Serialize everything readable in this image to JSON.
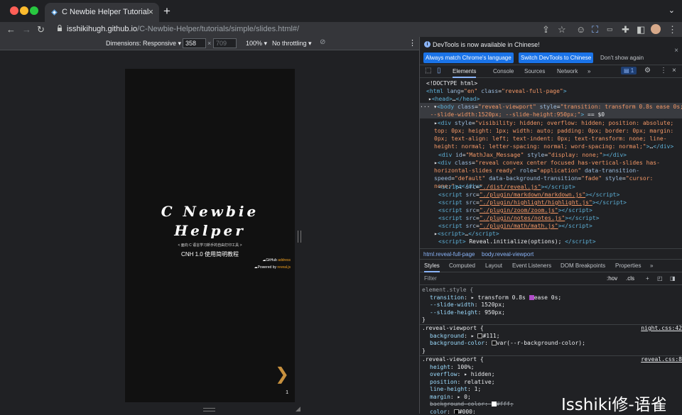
{
  "browser": {
    "tab_title": "C Newbie Helper Tutorial",
    "url_host": "isshikihugh.github.io",
    "url_path": "/C-Newbie-Helper/tutorials/simple/slides.html#/"
  },
  "devbar": {
    "dimensions": "Dimensions: Responsive ▾",
    "width": "358",
    "height": "709",
    "zoom": "100% ▾",
    "throttle": "No throttling ▾"
  },
  "slide": {
    "title1": "C Newbie",
    "title2": "Helper",
    "subtitle": "< 面向 C 语言学习新手的自由打印工具 >",
    "desc": "CNH 1.0 使用简明教程",
    "link1_prefix": "GitHub",
    "link1": "address",
    "link2_prefix": "Powered by",
    "link2": "reveal.js",
    "page": "1"
  },
  "notice": {
    "msg": "DevTools is now available in Chinese!",
    "btn1": "Always match Chrome's language",
    "btn2": "Switch DevTools to Chinese",
    "btn3": "Don't show again"
  },
  "dt_tabs": [
    "Elements",
    "Console",
    "Sources",
    "Network",
    "»"
  ],
  "badge": "1",
  "breadcrumb": [
    "html.reveal-full-page",
    "body.reveal-viewport"
  ],
  "style_tabs": [
    "Styles",
    "Computed",
    "Layout",
    "Event Listeners",
    "DOM Breakpoints",
    "Properties",
    "»"
  ],
  "filter": {
    "placeholder": "Filter",
    "hov": ":hov",
    ".cls": ".cls"
  },
  "watermark": "Isshiki修-语雀"
}
